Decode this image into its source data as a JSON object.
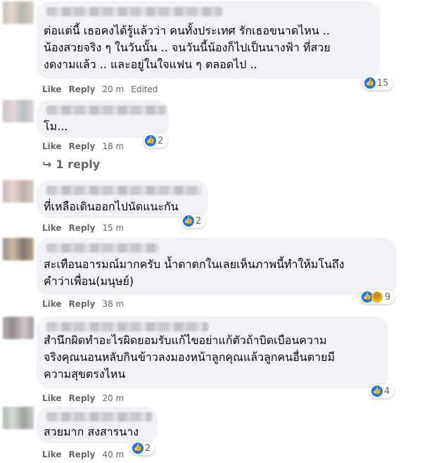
{
  "comments": [
    {
      "text": "ต่อแต่นี้ เธอคงได้รู้แล้วว่า คนทั้งประเทศ รักเธอขนาดไหน ..\nน้องสวยจริง ๆ ในวันนั้น .. จนวันนี้น้องก็ไปเป็นนางฟ้า ที่สวย\nงดงามแล้ว .. และอยู่ในใจแฟน ๆ ตลอดไป ..",
      "reaction_count": "15",
      "like_label": "Like",
      "reply_label": "Reply",
      "time": "20 m",
      "edited": "Edited"
    },
    {
      "text": "โม...",
      "reaction_count": "2",
      "like_label": "Like",
      "reply_label": "Reply",
      "time": "18 m",
      "replies": "1 reply"
    },
    {
      "text": "ที่เหลือเดินออกไปนัดแนะกัน",
      "reaction_count": "2",
      "like_label": "Like",
      "reply_label": "Reply",
      "time": "15 m"
    },
    {
      "text": "สะเทือนอารมณ์มากครับ น้ำตาตกในเลยเห็นภาพนี้ทำให้มโนถึง\nคำว่าเพื่อน(มนุษย์)",
      "reaction_count": "9",
      "like_label": "Like",
      "reply_label": "Reply",
      "time": "38 m"
    },
    {
      "text": "สำนึกผิดทำอะไรผิดยอมรับแก้ไขอย่าแก้ตัวถ้าบิดเบือนความ\nจริงคุณนอนหลับกินข้าวลงมองหน้าลูกคุณแล้วลูกคนอื่นตายมี\nความสุขตรงไหน",
      "reaction_count": "4",
      "like_label": "Like",
      "reply_label": "Reply",
      "time": "20 m"
    },
    {
      "text": "สวยมาก สงสารนาง",
      "reaction_count": "2",
      "like_label": "Like",
      "reply_label": "Reply",
      "time": "40 m"
    }
  ],
  "icons": {
    "like": "like-icon",
    "sad": "sad-icon",
    "reply_arrow": "reply-arrow-icon"
  },
  "colors": {
    "like_blue": "#1877f2",
    "bubble": "#f0f2f5",
    "meta": "#65676b"
  }
}
